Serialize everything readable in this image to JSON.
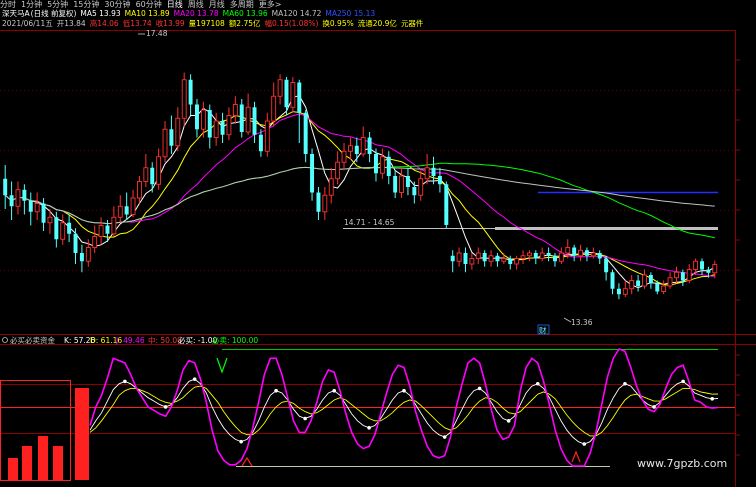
{
  "toolbar": {
    "tabs": [
      "分时",
      "1分钟",
      "5分钟",
      "15分钟",
      "30分钟",
      "60分钟",
      "日线",
      "周线",
      "月线",
      "多周期",
      "更多>"
    ]
  },
  "info_line1": {
    "stock_name": "深天马A",
    "adjust": "(日线 前复权)",
    "ma5": "MA5 13.93",
    "ma10": "MA10 13.89",
    "ma20": "MA20 13.78",
    "ma60": "MA60 13.96",
    "ma120": "MA120 14.72",
    "ma250": "MA250 15.13"
  },
  "info_line2": {
    "date": "2021/06/11五",
    "open": "开13.84",
    "high": "高14.06",
    "low": "低13.74",
    "close": "收13.99",
    "volume": "量197108",
    "amount": "额2.75亿",
    "change": "幅0.15(1.08%)",
    "turnover": "换0.95%",
    "float_cap": "流通20.9亿",
    "unit": "元器件"
  },
  "indicator": {
    "name": "必买必卖资金",
    "k": "K: 57.26",
    "d": "D: 61.16",
    "j": "J: 49.46",
    "mid": "中: 50.00",
    "buy": "必买: -1.00",
    "sell": "必卖: 100.00"
  },
  "annotations": {
    "high_label": "17.48",
    "range_label": "14.71 - 14.65",
    "low_label": "13.36",
    "finance_marker": "财"
  },
  "watermark": "www.7gpzb.com",
  "colors": {
    "up": "#ff3232",
    "down": "#54ffff",
    "ma5": "#ffffff",
    "ma10": "#ffff00",
    "ma20": "#ff00ff",
    "ma60": "#00ff00",
    "ma120": "#c0c0c0",
    "ma250": "#0000ff",
    "k": "#ffffff",
    "d": "#ffff00",
    "j": "#ff00ff"
  },
  "chart_data": [
    {
      "type": "candlestick",
      "title": "深天马A (日线 前复权)",
      "xlabel": "",
      "ylabel": "",
      "ylim": [
        12.8,
        18.2
      ],
      "annotations": [
        {
          "text": "17.48",
          "value": 17.48
        },
        {
          "text": "14.71 - 14.65",
          "value": 14.68
        },
        {
          "text": "13.36",
          "value": 13.36
        }
      ],
      "candles": [
        [
          15.55,
          15.25,
          15.8,
          15.0
        ],
        [
          15.25,
          15.05,
          15.5,
          14.8
        ],
        [
          15.05,
          15.35,
          15.5,
          14.9
        ],
        [
          15.35,
          15.15,
          15.45,
          14.9
        ],
        [
          15.15,
          14.95,
          15.3,
          14.7
        ],
        [
          14.95,
          15.1,
          15.3,
          14.8
        ],
        [
          15.1,
          14.75,
          15.2,
          14.6
        ],
        [
          14.75,
          14.85,
          15.0,
          14.55
        ],
        [
          14.85,
          14.45,
          14.95,
          14.3
        ],
        [
          14.45,
          14.75,
          14.9,
          14.35
        ],
        [
          14.75,
          14.55,
          14.9,
          14.4
        ],
        [
          14.55,
          14.2,
          14.65,
          14.0
        ],
        [
          14.2,
          14.05,
          14.35,
          13.85
        ],
        [
          14.05,
          14.3,
          14.45,
          13.95
        ],
        [
          14.3,
          14.5,
          14.7,
          14.2
        ],
        [
          14.5,
          14.7,
          14.85,
          14.35
        ],
        [
          14.7,
          14.55,
          14.8,
          14.4
        ],
        [
          14.55,
          14.85,
          15.05,
          14.5
        ],
        [
          14.85,
          15.05,
          15.25,
          14.75
        ],
        [
          15.05,
          14.9,
          15.3,
          14.8
        ],
        [
          14.9,
          15.2,
          15.35,
          14.85
        ],
        [
          15.2,
          15.5,
          15.6,
          15.1
        ],
        [
          15.5,
          15.75,
          16.0,
          15.4
        ],
        [
          15.75,
          15.45,
          15.85,
          15.3
        ],
        [
          15.45,
          15.95,
          16.1,
          15.35
        ],
        [
          15.95,
          16.45,
          16.6,
          15.85
        ],
        [
          16.45,
          16.15,
          16.7,
          16.0
        ],
        [
          16.15,
          16.65,
          16.85,
          16.05
        ],
        [
          16.65,
          17.35,
          17.48,
          16.5
        ],
        [
          17.35,
          16.9,
          17.45,
          16.7
        ],
        [
          16.9,
          16.45,
          17.0,
          16.3
        ],
        [
          16.45,
          16.8,
          16.95,
          16.3
        ],
        [
          16.8,
          16.3,
          16.9,
          16.1
        ],
        [
          16.3,
          16.6,
          16.75,
          16.15
        ],
        [
          16.6,
          16.35,
          16.75,
          16.2
        ],
        [
          16.35,
          16.7,
          16.85,
          16.25
        ],
        [
          16.7,
          16.9,
          17.05,
          16.55
        ],
        [
          16.9,
          16.4,
          17.0,
          16.3
        ],
        [
          16.4,
          16.85,
          17.1,
          16.35
        ],
        [
          16.85,
          16.35,
          16.95,
          16.2
        ],
        [
          16.35,
          16.05,
          16.45,
          15.95
        ],
        [
          16.05,
          16.6,
          16.75,
          15.95
        ],
        [
          16.6,
          17.05,
          17.3,
          16.5
        ],
        [
          17.05,
          17.35,
          17.45,
          16.9
        ],
        [
          17.35,
          16.85,
          17.4,
          16.7
        ],
        [
          16.85,
          17.3,
          17.4,
          16.75
        ],
        [
          17.3,
          16.75,
          17.35,
          16.2
        ],
        [
          16.75,
          16.0,
          16.8,
          15.85
        ],
        [
          16.0,
          15.3,
          16.1,
          15.15
        ],
        [
          15.3,
          14.95,
          15.4,
          14.8
        ],
        [
          14.95,
          15.25,
          15.4,
          14.8
        ],
        [
          15.25,
          15.55,
          15.75,
          15.1
        ],
        [
          15.55,
          15.85,
          16.05,
          15.45
        ],
        [
          15.85,
          16.05,
          16.2,
          15.7
        ],
        [
          16.05,
          16.15,
          16.3,
          15.9
        ],
        [
          16.15,
          16.0,
          16.3,
          15.85
        ],
        [
          16.0,
          16.3,
          16.5,
          15.95
        ],
        [
          16.3,
          16.0,
          16.4,
          15.85
        ],
        [
          16.0,
          15.65,
          16.1,
          15.5
        ],
        [
          15.65,
          15.95,
          16.1,
          15.55
        ],
        [
          15.95,
          15.6,
          16.05,
          15.45
        ],
        [
          15.6,
          15.3,
          15.7,
          15.2
        ],
        [
          15.3,
          15.6,
          15.75,
          15.2
        ],
        [
          15.6,
          15.4,
          15.75,
          15.25
        ],
        [
          15.4,
          15.25,
          15.5,
          15.1
        ],
        [
          15.25,
          15.55,
          15.7,
          15.15
        ],
        [
          15.55,
          15.75,
          16.0,
          15.45
        ],
        [
          15.75,
          15.6,
          15.95,
          15.45
        ],
        [
          15.6,
          15.45,
          15.75,
          15.3
        ],
        [
          15.45,
          14.71,
          15.5,
          14.65
        ],
        [
          14.15,
          14.05,
          14.25,
          13.85
        ],
        [
          14.05,
          14.2,
          14.3,
          13.95
        ],
        [
          14.2,
          14.0,
          14.3,
          13.85
        ],
        [
          14.0,
          14.1,
          14.2,
          13.9
        ],
        [
          14.1,
          14.2,
          14.3,
          14.0
        ],
        [
          14.2,
          14.05,
          14.25,
          13.95
        ],
        [
          14.05,
          14.15,
          14.25,
          13.95
        ],
        [
          14.15,
          14.05,
          14.2,
          13.95
        ],
        [
          14.05,
          14.1,
          14.2,
          14.0
        ],
        [
          14.1,
          14.0,
          14.15,
          13.9
        ],
        [
          14.0,
          14.1,
          14.15,
          13.9
        ],
        [
          14.1,
          14.15,
          14.25,
          14.0
        ],
        [
          14.15,
          14.2,
          14.25,
          14.05
        ],
        [
          14.2,
          14.1,
          14.25,
          14.0
        ],
        [
          14.1,
          14.2,
          14.3,
          14.05
        ],
        [
          14.2,
          14.15,
          14.3,
          14.05
        ],
        [
          14.15,
          14.05,
          14.2,
          13.95
        ],
        [
          14.05,
          14.2,
          14.3,
          14.0
        ],
        [
          14.2,
          14.3,
          14.45,
          14.1
        ],
        [
          14.3,
          14.15,
          14.35,
          14.05
        ],
        [
          14.15,
          14.25,
          14.35,
          14.05
        ],
        [
          14.25,
          14.15,
          14.3,
          14.05
        ],
        [
          14.15,
          14.2,
          14.3,
          14.1
        ],
        [
          14.2,
          14.1,
          14.25,
          14.0
        ],
        [
          14.1,
          13.85,
          14.15,
          13.7
        ],
        [
          13.85,
          13.55,
          13.9,
          13.45
        ],
        [
          13.55,
          13.45,
          13.65,
          13.36
        ],
        [
          13.45,
          13.55,
          13.7,
          13.4
        ],
        [
          13.55,
          13.7,
          13.8,
          13.45
        ],
        [
          13.7,
          13.6,
          13.8,
          13.5
        ],
        [
          13.6,
          13.8,
          13.9,
          13.55
        ],
        [
          13.8,
          13.65,
          13.85,
          13.55
        ],
        [
          13.65,
          13.5,
          13.7,
          13.45
        ],
        [
          13.5,
          13.6,
          13.7,
          13.45
        ],
        [
          13.6,
          13.75,
          13.85,
          13.55
        ],
        [
          13.75,
          13.85,
          13.95,
          13.65
        ],
        [
          13.85,
          13.7,
          13.9,
          13.6
        ],
        [
          13.7,
          13.9,
          14.0,
          13.65
        ],
        [
          13.9,
          14.05,
          14.1,
          13.8
        ],
        [
          14.05,
          13.9,
          14.1,
          13.8
        ],
        [
          13.9,
          13.84,
          13.95,
          13.75
        ],
        [
          13.84,
          13.99,
          14.06,
          13.74
        ]
      ]
    },
    {
      "type": "line",
      "title": "必买必卖资金",
      "xlabel": "",
      "ylabel": "",
      "ylim": [
        -12,
        112
      ],
      "reference_lines": [
        {
          "name": "中",
          "value": 50
        },
        {
          "name": "必买",
          "value": -1
        },
        {
          "name": "必卖",
          "value": 100
        }
      ],
      "series": [
        {
          "name": "K",
          "values": [
            30,
            38,
            45,
            55,
            65,
            70,
            72,
            70,
            66,
            62,
            58,
            55,
            52,
            50,
            52,
            58,
            66,
            72,
            74,
            70,
            62,
            50,
            40,
            32,
            26,
            22,
            20,
            22,
            28,
            38,
            50,
            60,
            64,
            62,
            56,
            48,
            42,
            40,
            42,
            48,
            56,
            62,
            64,
            60,
            52,
            44,
            38,
            34,
            32,
            34,
            40,
            48,
            56,
            62,
            64,
            60,
            52,
            44,
            36,
            30,
            26,
            24,
            28,
            38,
            48,
            58,
            64,
            66,
            62,
            54,
            46,
            40,
            38,
            42,
            52,
            62,
            68,
            70,
            66,
            58,
            48,
            38,
            30,
            24,
            20,
            18,
            20,
            26,
            36,
            48,
            58,
            66,
            70,
            68,
            62,
            56,
            52,
            50,
            54,
            60,
            66,
            70,
            72,
            68,
            62,
            60,
            58,
            57,
            57.26
          ]
        },
        {
          "name": "D",
          "values": [
            28,
            32,
            38,
            45,
            52,
            60,
            64,
            66,
            66,
            64,
            62,
            59,
            56,
            54,
            53,
            55,
            58,
            63,
            67,
            68,
            66,
            60,
            54,
            46,
            39,
            33,
            28,
            26,
            26,
            30,
            36,
            44,
            50,
            54,
            55,
            53,
            49,
            46,
            44,
            45,
            48,
            52,
            56,
            58,
            56,
            52,
            48,
            44,
            40,
            38,
            38,
            41,
            45,
            50,
            54,
            56,
            55,
            51,
            46,
            41,
            36,
            32,
            30,
            32,
            37,
            43,
            50,
            55,
            58,
            57,
            54,
            49,
            45,
            44,
            46,
            51,
            56,
            61,
            63,
            61,
            57,
            50,
            43,
            37,
            32,
            28,
            25,
            25,
            28,
            34,
            41,
            49,
            56,
            60,
            61,
            59,
            57,
            55,
            55,
            57,
            60,
            63,
            66,
            66,
            65,
            63,
            62,
            61,
            61.16
          ]
        },
        {
          "name": "J",
          "values": [
            34,
            50,
            60,
            75,
            92,
            90,
            88,
            78,
            66,
            58,
            50,
            47,
            44,
            42,
            50,
            64,
            82,
            90,
            88,
            74,
            54,
            30,
            12,
            4,
            0,
            0,
            4,
            14,
            32,
            54,
            78,
            92,
            92,
            78,
            58,
            38,
            28,
            28,
            38,
            54,
            72,
            82,
            80,
            64,
            44,
            28,
            18,
            14,
            16,
            26,
            44,
            62,
            78,
            86,
            84,
            68,
            46,
            30,
            16,
            8,
            6,
            8,
            24,
            50,
            70,
            88,
            92,
            88,
            70,
            48,
            30,
            22,
            24,
            34,
            64,
            84,
            92,
            88,
            72,
            52,
            30,
            14,
            4,
            -1,
            -1,
            -1,
            10,
            28,
            52,
            76,
            92,
            100,
            98,
            84,
            68,
            56,
            48,
            46,
            52,
            66,
            78,
            84,
            86,
            72,
            56,
            54,
            50,
            49,
            49.46
          ]
        }
      ]
    }
  ]
}
